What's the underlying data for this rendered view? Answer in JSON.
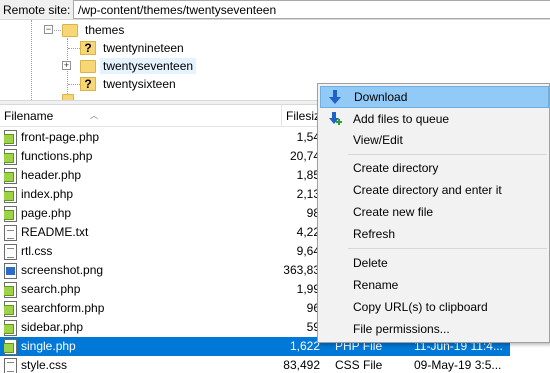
{
  "remote": {
    "label": "Remote site:",
    "path": "/wp-content/themes/twentyseventeen"
  },
  "tree": {
    "parent": "themes",
    "children": [
      "twentynineteen",
      "twentyseventeen",
      "twentysixteen"
    ]
  },
  "columns": {
    "filename": "Filename",
    "filesize": "Filesiz"
  },
  "files": [
    {
      "name": "front-page.php",
      "size": "1,54",
      "type": "",
      "date": "",
      "icon": "php"
    },
    {
      "name": "functions.php",
      "size": "20,74",
      "type": "",
      "date": "",
      "icon": "php"
    },
    {
      "name": "header.php",
      "size": "1,85",
      "type": "",
      "date": "",
      "icon": "php"
    },
    {
      "name": "index.php",
      "size": "2,13",
      "type": "",
      "date": "",
      "icon": "php"
    },
    {
      "name": "page.php",
      "size": "98",
      "type": "",
      "date": "",
      "icon": "php"
    },
    {
      "name": "README.txt",
      "size": "4,22",
      "type": "",
      "date": "",
      "icon": "txt"
    },
    {
      "name": "rtl.css",
      "size": "9,64",
      "type": "",
      "date": "",
      "icon": "css"
    },
    {
      "name": "screenshot.png",
      "size": "363,83",
      "type": "",
      "date": "",
      "icon": "png"
    },
    {
      "name": "search.php",
      "size": "1,99",
      "type": "",
      "date": "",
      "icon": "php"
    },
    {
      "name": "searchform.php",
      "size": "96",
      "type": "",
      "date": "",
      "icon": "php"
    },
    {
      "name": "sidebar.php",
      "size": "59",
      "type": "",
      "date": "",
      "icon": "php"
    },
    {
      "name": "single.php",
      "size": "1,622",
      "type": "PHP File",
      "date": "11-Jun-19 11:4...",
      "icon": "php"
    },
    {
      "name": "style.css",
      "size": "83,492",
      "type": "CSS File",
      "date": "09-May-19 3:5...",
      "icon": "css"
    }
  ],
  "selected_index": 11,
  "context_menu": {
    "items": [
      {
        "label": "Download",
        "icon": "download-icon"
      },
      {
        "label": "Add files to queue",
        "icon": "add-to-queue-icon"
      },
      {
        "label": "View/Edit"
      },
      {
        "label": "Create directory"
      },
      {
        "label": "Create directory and enter it"
      },
      {
        "label": "Create new file"
      },
      {
        "label": "Refresh"
      },
      {
        "label": "Delete"
      },
      {
        "label": "Rename"
      },
      {
        "label": "Copy URL(s) to clipboard"
      },
      {
        "label": "File permissions..."
      }
    ],
    "hovered": "Download"
  },
  "colors": {
    "selection": "#0078d7",
    "menu_hover": "#91c9f7",
    "folder": "#f7d675"
  }
}
